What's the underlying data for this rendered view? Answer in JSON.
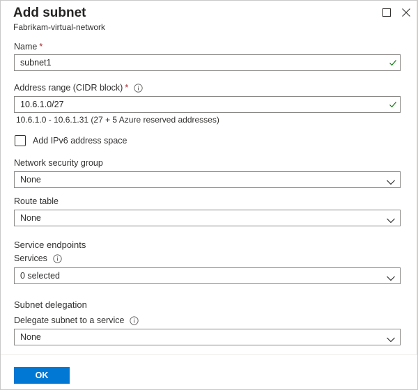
{
  "panel": {
    "title": "Add subnet",
    "subtitle": "Fabrikam-virtual-network",
    "maximize_icon": "maximize-icon",
    "close_icon": "close-icon"
  },
  "form": {
    "name": {
      "label": "Name",
      "required_mark": "*",
      "value": "subnet1",
      "valid": true
    },
    "address_range": {
      "label": "Address range (CIDR block)",
      "required_mark": "*",
      "value": "10.6.1.0/27",
      "hint": "10.6.1.0 - 10.6.1.31 (27 + 5 Azure reserved addresses)",
      "valid": true
    },
    "ipv6": {
      "label": "Add IPv6 address space",
      "checked": false
    },
    "nsg": {
      "label": "Network security group",
      "selected": "None"
    },
    "route_table": {
      "label": "Route table",
      "selected": "None"
    },
    "service_endpoints": {
      "section_title": "Service endpoints",
      "services_label": "Services",
      "selected": "0 selected"
    },
    "delegation": {
      "section_title": "Subnet delegation",
      "label": "Delegate subnet to a service",
      "selected": "None"
    }
  },
  "footer": {
    "ok_label": "OK"
  },
  "colors": {
    "primary": "#0078d4",
    "required": "#a4262c",
    "valid_check": "#107c10"
  }
}
